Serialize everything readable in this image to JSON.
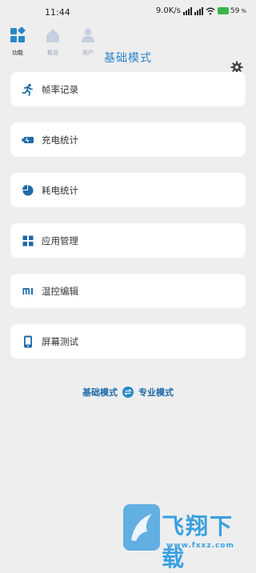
{
  "status": {
    "time": "11:44",
    "net_speed": "9.0K/s",
    "battery": "59"
  },
  "nav": {
    "items": [
      {
        "label": "功能",
        "icon": "grid-icon",
        "active": true
      },
      {
        "label": "概览",
        "icon": "house-icon",
        "active": false
      },
      {
        "label": "用户",
        "icon": "user-icon",
        "active": false
      }
    ]
  },
  "page_title": "基础模式",
  "menu": [
    {
      "label": "帧率记录",
      "icon": "running-man-icon"
    },
    {
      "label": "充电统计",
      "icon": "battery-charge-icon"
    },
    {
      "label": "耗电统计",
      "icon": "pie-chart-icon"
    },
    {
      "label": "应用管理",
      "icon": "app-grid-icon"
    },
    {
      "label": "温控编辑",
      "icon": "mi-logo-icon"
    },
    {
      "label": "屏幕测试",
      "icon": "phone-screen-icon"
    }
  ],
  "mode_switch": {
    "current": "基础模式",
    "other": "专业模式"
  },
  "watermark": {
    "text": "飞翔下载",
    "url": "www.fxxz.com"
  },
  "colors": {
    "accent": "#2a86c8",
    "background": "#eeeeef"
  }
}
